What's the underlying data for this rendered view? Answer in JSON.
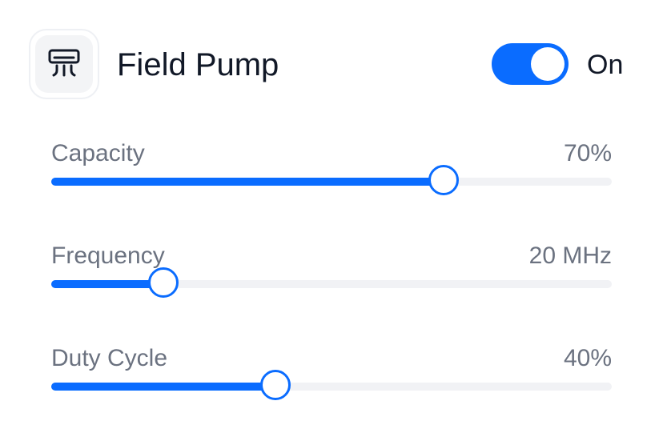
{
  "device": {
    "icon": "air-conditioner-icon",
    "name": "Field Pump",
    "power": {
      "state": true,
      "label": "On"
    }
  },
  "colors": {
    "accent": "#0a6cff",
    "track": "#f1f2f5",
    "label": "#6b7280",
    "title": "#111827"
  },
  "sliders": [
    {
      "label": "Capacity",
      "value_text": "70%",
      "fraction": 0.7
    },
    {
      "label": "Frequency",
      "value_text": "20 MHz",
      "fraction": 0.2
    },
    {
      "label": "Duty Cycle",
      "value_text": "40%",
      "fraction": 0.4
    }
  ]
}
